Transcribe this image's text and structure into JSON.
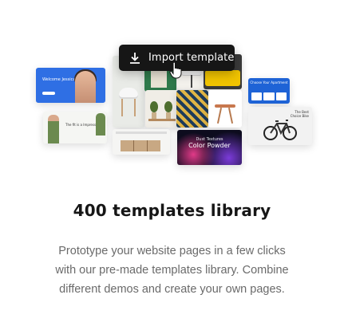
{
  "collage": {
    "import_button_label": "Import template",
    "profile_card_text": "Welcome Jessica",
    "man_card_text": "The fit is a Impression ...",
    "apartment_card_text": "Choose Your Apartment",
    "bike_card_text": "The Best Choice Bike",
    "powder_line1": "Dust Textures",
    "powder_line2": "Color Powder"
  },
  "heading": "400 templates library",
  "description": "Prototype your website pages in a few clicks with our pre-made templates library. Combine different demos and create your own pages."
}
